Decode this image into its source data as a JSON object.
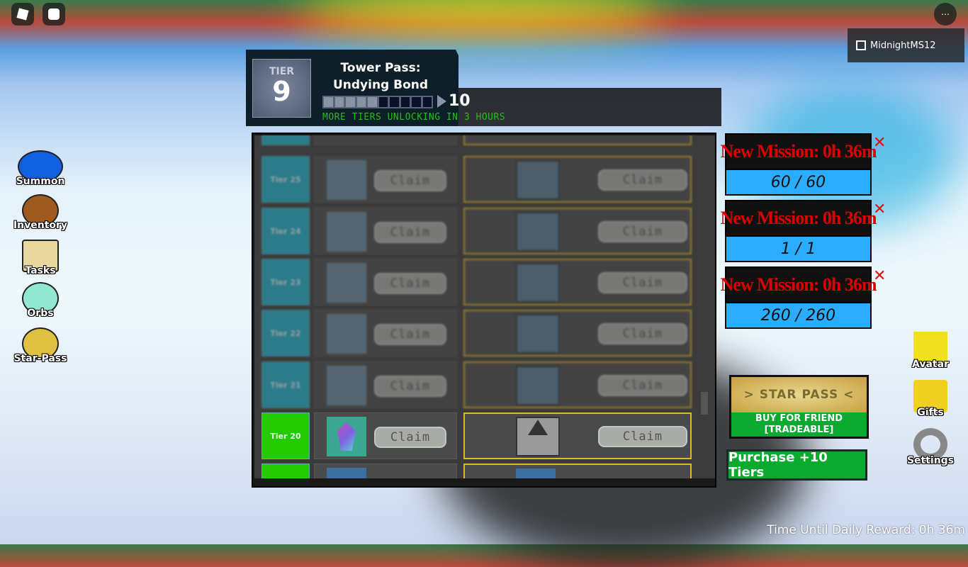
{
  "topbar": {
    "username": "MidnightMS12"
  },
  "header": {
    "tier_label": "TIER",
    "tier_value": "9",
    "title_line1": "Tower Pass:",
    "title_line2": "Undying Bond",
    "next_tier": "10",
    "progress_fraction": 0.5,
    "unlock_notice": "MORE TIERS UNLOCKING IN 3 HOURS"
  },
  "pass_rows": [
    {
      "tier": "Tier 25",
      "free_claim": "Claim",
      "premium_claim": "Claim",
      "unlocked": false
    },
    {
      "tier": "Tier 24",
      "free_claim": "Claim",
      "premium_claim": "Claim",
      "unlocked": false
    },
    {
      "tier": "Tier 23",
      "free_claim": "Claim",
      "premium_claim": "Claim",
      "unlocked": false
    },
    {
      "tier": "Tier 22",
      "free_claim": "Claim",
      "premium_claim": "Claim",
      "unlocked": false
    },
    {
      "tier": "Tier 21",
      "free_claim": "Claim",
      "premium_claim": "Claim",
      "unlocked": false
    },
    {
      "tier": "Tier 20",
      "free_claim": "Claim",
      "premium_claim": "Claim",
      "unlocked": true
    }
  ],
  "missions": [
    {
      "title": "New Mission: 0h 36m",
      "progress": "60 / 60"
    },
    {
      "title": "New Mission: 0h 36m",
      "progress": "1 / 1"
    },
    {
      "title": "New Mission: 0h 36m",
      "progress": "260 / 260"
    }
  ],
  "star_pass": {
    "label": "> STAR PASS <",
    "buy_for_friend": "BUY FOR FRIEND",
    "tradeable": "[TRADEABLE]"
  },
  "purchase_tiers": "Purchase +10 Tiers",
  "left_menu": [
    "Summon",
    "Inventory",
    "Tasks",
    "Orbs",
    "Star-Pass"
  ],
  "right_menu": [
    "Avatar",
    "Gifts",
    "Settings"
  ],
  "daily_reward": "Time Until Daily Reward: 0h 36m",
  "colors": {
    "tier_locked": "#1fb0cc",
    "tier_unlocked": "#22cc00",
    "premium_border": "#e6b820",
    "mission_title": "#dd0000",
    "mission_bar": "#2aacff",
    "purchase": "#0aaa30"
  }
}
